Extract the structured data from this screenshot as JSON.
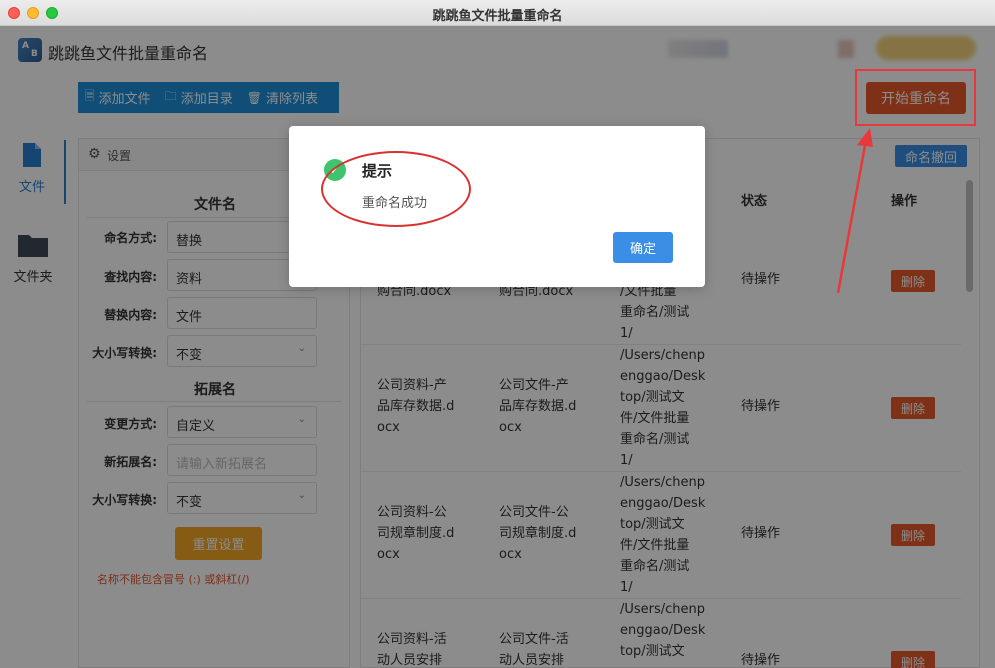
{
  "window": {
    "title": "跳跳鱼文件批量重命名"
  },
  "app": {
    "title": "跳跳鱼文件批量重命名",
    "logo_letters": [
      "A",
      "B"
    ]
  },
  "toolbar": {
    "add_file": "添加文件",
    "add_dir": "添加目录",
    "clear_list": "清除列表",
    "start": "开始重命名"
  },
  "nav": {
    "files": "文件",
    "folder": "文件夹"
  },
  "settings": {
    "header": "设置",
    "filename_section": "文件名",
    "naming_mode_label": "命名方式:",
    "naming_mode_value": "替换",
    "find_label": "查找内容:",
    "find_value": "资料",
    "replace_label": "替换内容:",
    "replace_value": "文件",
    "case_label": "大小写转换:",
    "case_value": "不变",
    "ext_section": "拓展名",
    "change_mode_label": "变更方式:",
    "change_mode_value": "自定义",
    "new_ext_label": "新拓展名:",
    "new_ext_placeholder": "请输入新拓展名",
    "ext_case_label": "大小写转换:",
    "ext_case_value": "不变",
    "reset": "重置设置",
    "warning": "名称不能包含冒号 (:) 或斜杠(/)"
  },
  "table": {
    "undo": "命名撤回",
    "headers": {
      "status": "状态",
      "action": "操作"
    },
    "rows": [
      {
        "orig": "购合同.docx",
        "new": "购合同.docx",
        "path": "/文件批量\n重命名/测试\n1/",
        "status": "待操作",
        "action": "删除"
      },
      {
        "orig": "公司资料-产\n品库存数据.d\nocx",
        "new": "公司文件-产\n品库存数据.d\nocx",
        "path": "/Users/chenp\nenggao/Desk\ntop/测试文\n件/文件批量\n重命名/测试\n1/",
        "status": "待操作",
        "action": "删除"
      },
      {
        "orig": "公司资料-公\n司规章制度.d\nocx",
        "new": "公司文件-公\n司规章制度.d\nocx",
        "path": "/Users/chenp\nenggao/Desk\ntop/测试文\n件/文件批量\n重命名/测试\n1/",
        "status": "待操作",
        "action": "删除"
      },
      {
        "orig": "公司资料-活\n动人员安排",
        "new": "公司文件-活\n动人员安排",
        "path": "/Users/chenp\nenggao/Desk\ntop/测试文",
        "status": "待操作",
        "action": "删除"
      }
    ]
  },
  "dialog": {
    "title": "提示",
    "message": "重命名成功",
    "ok": "确定"
  },
  "colors": {
    "accent": "#1e8ed9",
    "danger": "#e85a2c",
    "annotation": "#e8383a",
    "success": "#3ec46d"
  }
}
